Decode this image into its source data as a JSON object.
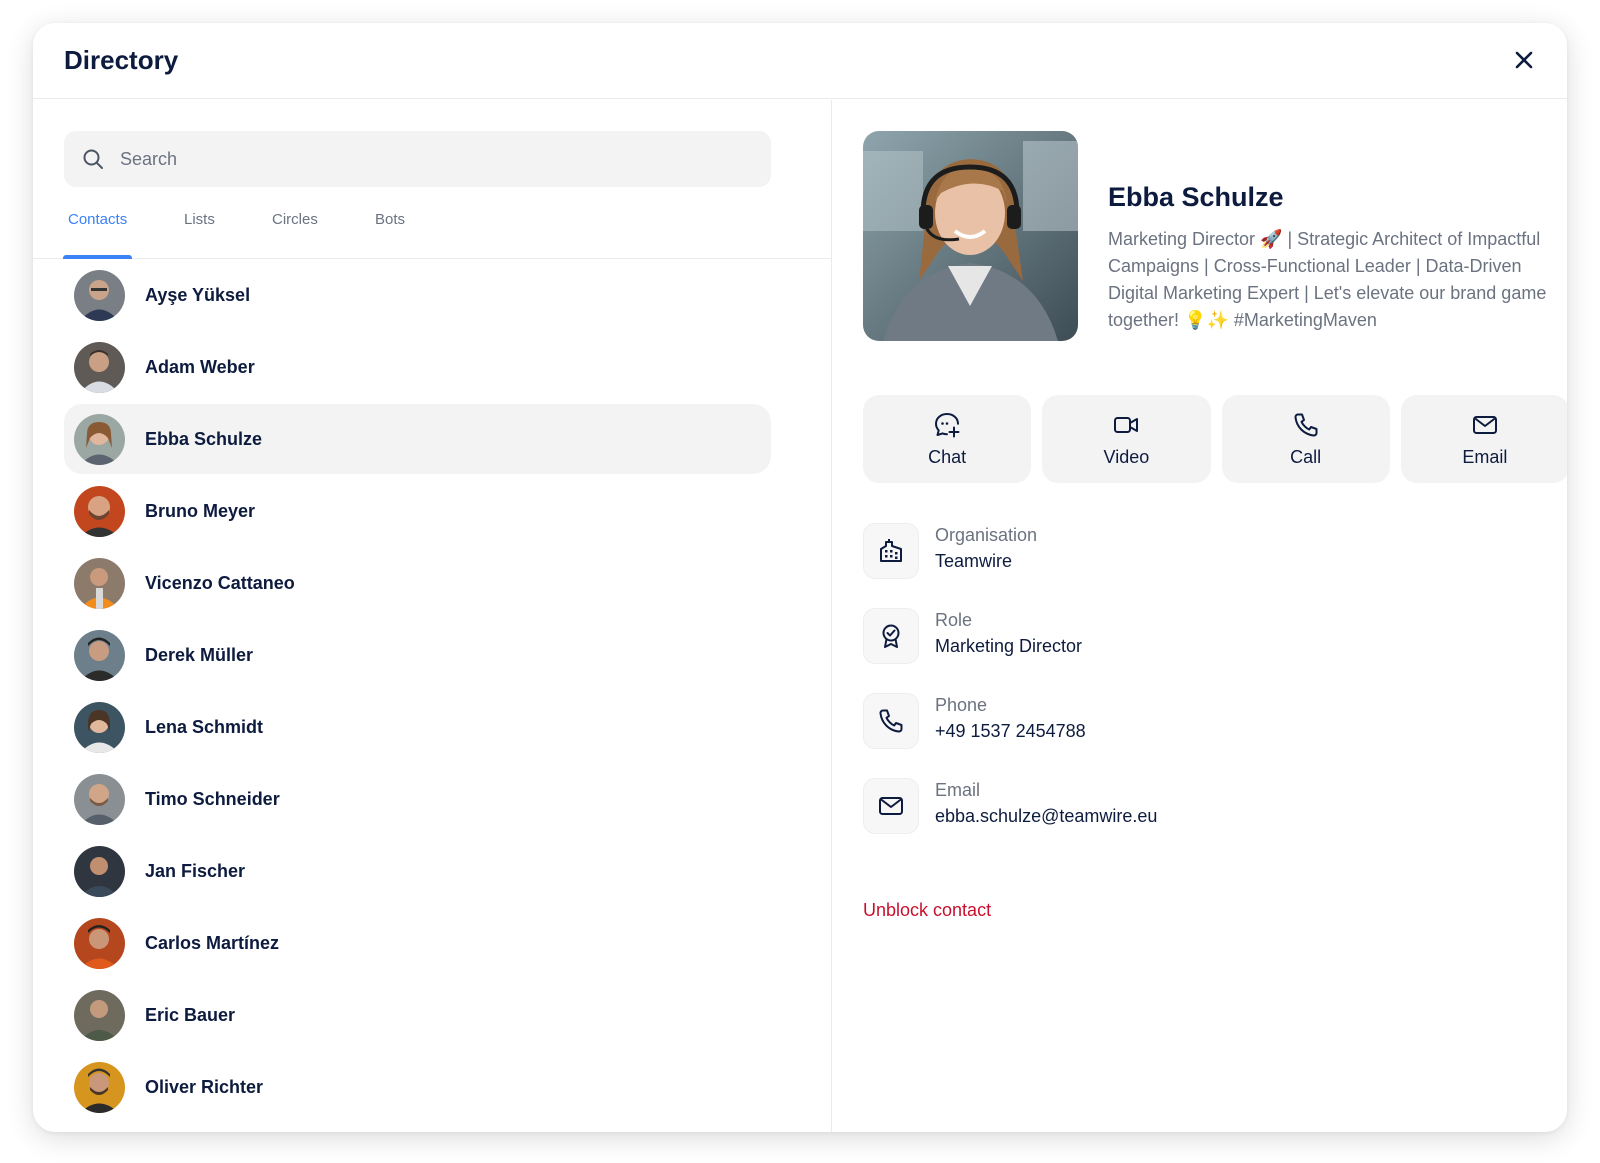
{
  "dialog": {
    "title": "Directory",
    "close_icon": "close-icon"
  },
  "search": {
    "placeholder": "Search",
    "value": ""
  },
  "tabs": [
    {
      "label": "Contacts",
      "active": true
    },
    {
      "label": "Lists",
      "active": false
    },
    {
      "label": "Circles",
      "active": false
    },
    {
      "label": "Bots",
      "active": false
    }
  ],
  "contacts": [
    {
      "name": "Ayşe Yüksel"
    },
    {
      "name": "Adam Weber"
    },
    {
      "name": "Ebba Schulze",
      "selected": true
    },
    {
      "name": "Bruno Meyer"
    },
    {
      "name": "Vicenzo Cattaneo"
    },
    {
      "name": "Derek Müller"
    },
    {
      "name": "Lena Schmidt"
    },
    {
      "name": "Timo Schneider"
    },
    {
      "name": "Jan Fischer"
    },
    {
      "name": "Carlos Martínez"
    },
    {
      "name": "Eric Bauer"
    },
    {
      "name": "Oliver Richter"
    }
  ],
  "profile": {
    "name": "Ebba Schulze",
    "bio": "Marketing Director 🚀 | Strategic Architect of Impactful Campaigns | Cross-Functional Leader | Data-Driven Digital Marketing Expert | Let's elevate our brand game together! 💡✨ #MarketingMaven",
    "actions": [
      {
        "label": "Chat",
        "icon": "chat-plus-icon"
      },
      {
        "label": "Video",
        "icon": "video-camera-icon"
      },
      {
        "label": "Call",
        "icon": "phone-icon"
      },
      {
        "label": "Email",
        "icon": "envelope-icon"
      }
    ],
    "details": [
      {
        "label": "Organisation",
        "value": "Teamwire",
        "icon": "building-icon"
      },
      {
        "label": "Role",
        "value": "Marketing Director",
        "icon": "badge-icon"
      },
      {
        "label": "Phone",
        "value": "+49 1537 2454788",
        "icon": "phone-icon"
      },
      {
        "label": "Email",
        "value": "ebba.schulze@teamwire.eu",
        "icon": "envelope-icon"
      }
    ],
    "unblock_label": "Unblock contact"
  },
  "colors": {
    "accent": "#3b82f6",
    "danger": "#c8102e",
    "text": "#0d1b3e",
    "muted": "#6b7280",
    "surface": "#f3f3f4"
  }
}
